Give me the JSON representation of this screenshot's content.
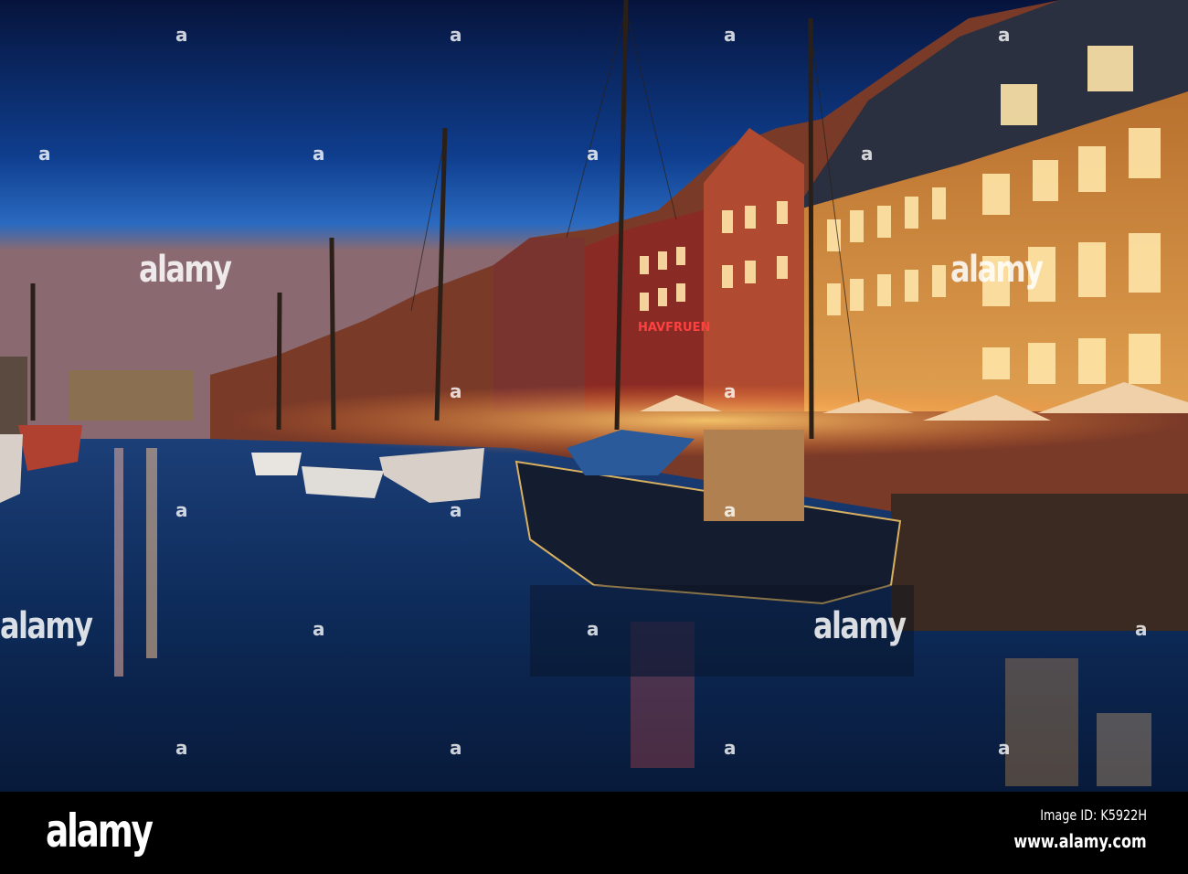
{
  "photo": {
    "subject": "Nyhavn harbour at dusk",
    "sign_text": "HAVFRUEN",
    "colors": {
      "sky_top": "#071a4a",
      "sky_bottom": "#1d5ab0",
      "water": "#0d2a55",
      "glow": "#ffb347",
      "sign": "#ff3030"
    }
  },
  "watermarks": {
    "text": "alamy",
    "mark": "a"
  },
  "footer": {
    "logo": "alamy",
    "image_id": "Image ID: K5922H",
    "url": "www.alamy.com"
  }
}
